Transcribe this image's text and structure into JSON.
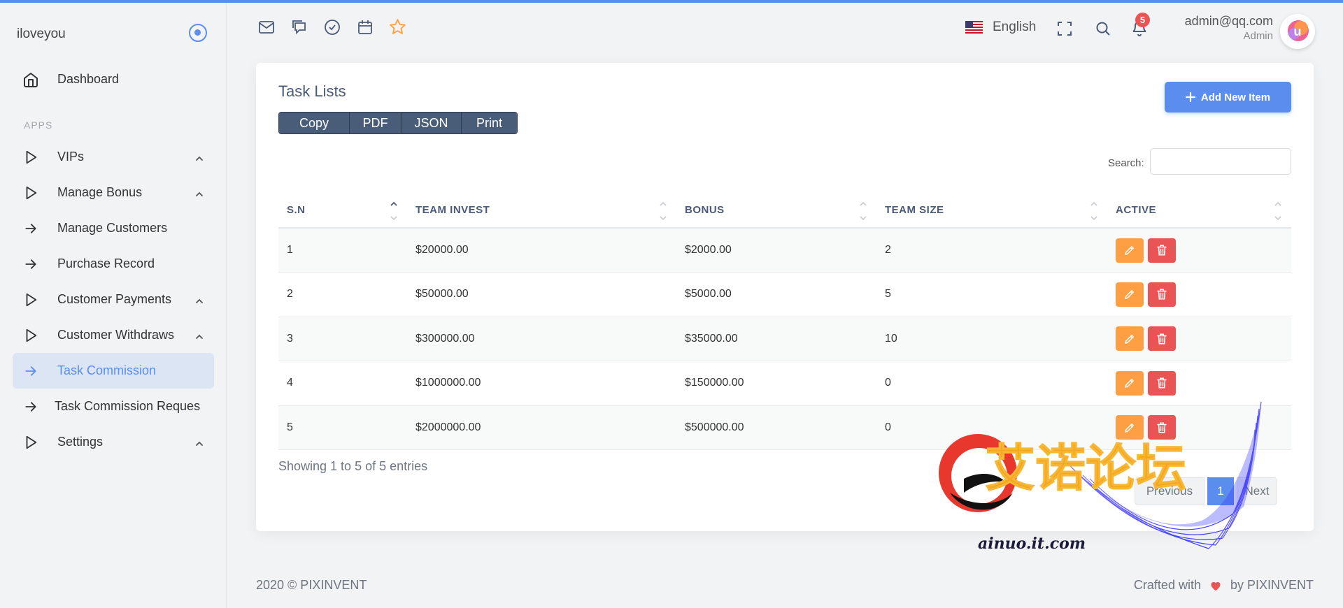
{
  "brand": {
    "name": "iloveyou"
  },
  "sidebar": {
    "items_top": [
      {
        "label": "Dashboard",
        "icon": "home-icon"
      }
    ],
    "section_label": "APPS",
    "items": [
      {
        "label": "VIPs",
        "icon": "play-outline-icon",
        "chevron": true
      },
      {
        "label": "Manage Bonus",
        "icon": "play-outline-icon",
        "chevron": true
      },
      {
        "label": "Manage Customers",
        "icon": "arrow-right-icon",
        "chevron": false
      },
      {
        "label": "Purchase Record",
        "icon": "arrow-right-icon",
        "chevron": false
      },
      {
        "label": "Customer Payments",
        "icon": "play-outline-icon",
        "chevron": true
      },
      {
        "label": "Customer Withdraws",
        "icon": "play-outline-icon",
        "chevron": true
      },
      {
        "label": "Task Commission",
        "icon": "arrow-right-icon",
        "chevron": false,
        "active": true
      },
      {
        "label": "Task Commission Reques",
        "icon": "arrow-right-icon",
        "chevron": false
      },
      {
        "label": "Settings",
        "icon": "play-outline-icon",
        "chevron": true
      }
    ]
  },
  "header": {
    "language": "English",
    "notification_count": "5",
    "user_email": "admin@qq.com",
    "user_role": "Admin"
  },
  "card": {
    "title": "Task Lists",
    "export_buttons": [
      "Copy",
      "PDF",
      "JSON",
      "Print"
    ],
    "add_button": "Add New Item",
    "search_label": "Search:",
    "search_value": ""
  },
  "table": {
    "columns": [
      "S.N",
      "TEAM INVEST",
      "BONUS",
      "TEAM SIZE",
      "ACTIVE"
    ],
    "rows": [
      [
        "1",
        "$20000.00",
        "$2000.00",
        "2"
      ],
      [
        "2",
        "$50000.00",
        "$5000.00",
        "5"
      ],
      [
        "3",
        "$300000.00",
        "$35000.00",
        "10"
      ],
      [
        "4",
        "$1000000.00",
        "$150000.00",
        "0"
      ],
      [
        "5",
        "$2000000.00",
        "$500000.00",
        "0"
      ]
    ]
  },
  "pagination": {
    "info": "Showing 1 to 5 of 5 entries",
    "previous": "Previous",
    "current": "1",
    "next": "Next"
  },
  "watermark": {
    "cjk": "艾诺论坛",
    "url": "ainuo.it.com"
  },
  "footer": {
    "left": "2020 © PIXINVENT",
    "right_prefix": "Crafted with",
    "right_suffix": "by PIXINVENT"
  },
  "colors": {
    "primary": "#5b8def",
    "warning": "#ff9f43",
    "danger": "#ea5455",
    "button_group": "#4a5d78"
  }
}
